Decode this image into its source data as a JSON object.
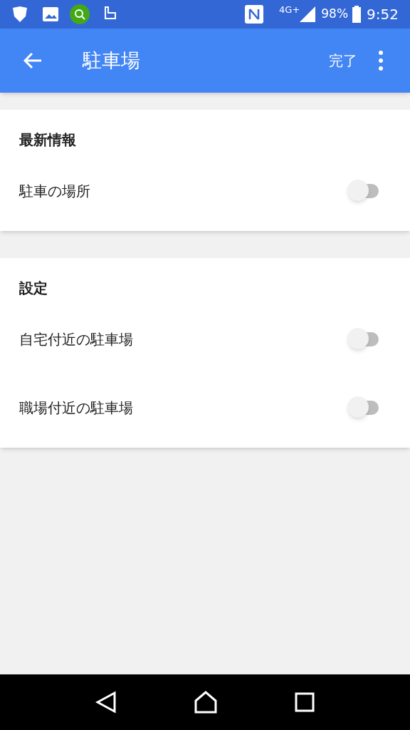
{
  "status_bar": {
    "network": "4G+",
    "battery": "98%",
    "time": "9:52"
  },
  "app_bar": {
    "title": "駐車場",
    "action": "完了"
  },
  "sections": [
    {
      "title": "最新情報",
      "items": [
        {
          "label": "駐車の場所",
          "on": false
        }
      ]
    },
    {
      "title": "設定",
      "items": [
        {
          "label": "自宅付近の駐車場",
          "on": false
        },
        {
          "label": "職場付近の駐車場",
          "on": false
        }
      ]
    }
  ]
}
